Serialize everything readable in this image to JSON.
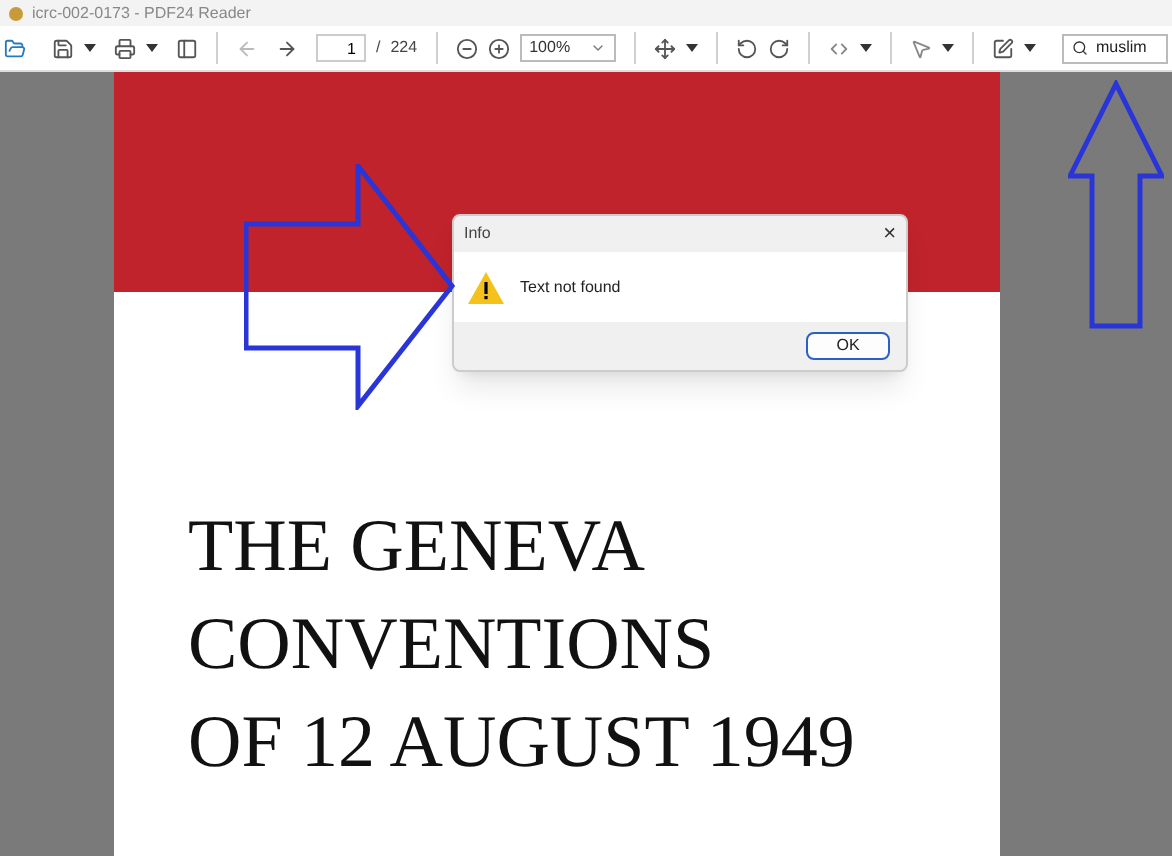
{
  "window": {
    "title": "icrc-002-0173 - PDF24 Reader"
  },
  "toolbar": {
    "page_current": "1",
    "page_separator": "/",
    "page_total": "224",
    "zoom": "100%",
    "search_value": "muslim"
  },
  "document": {
    "title_lines": [
      "THE GENEVA",
      "CONVENTIONS",
      "OF 12 AUGUST 1949"
    ]
  },
  "dialog": {
    "title": "Info",
    "close": "×",
    "message": "Text not found",
    "button": "OK"
  }
}
